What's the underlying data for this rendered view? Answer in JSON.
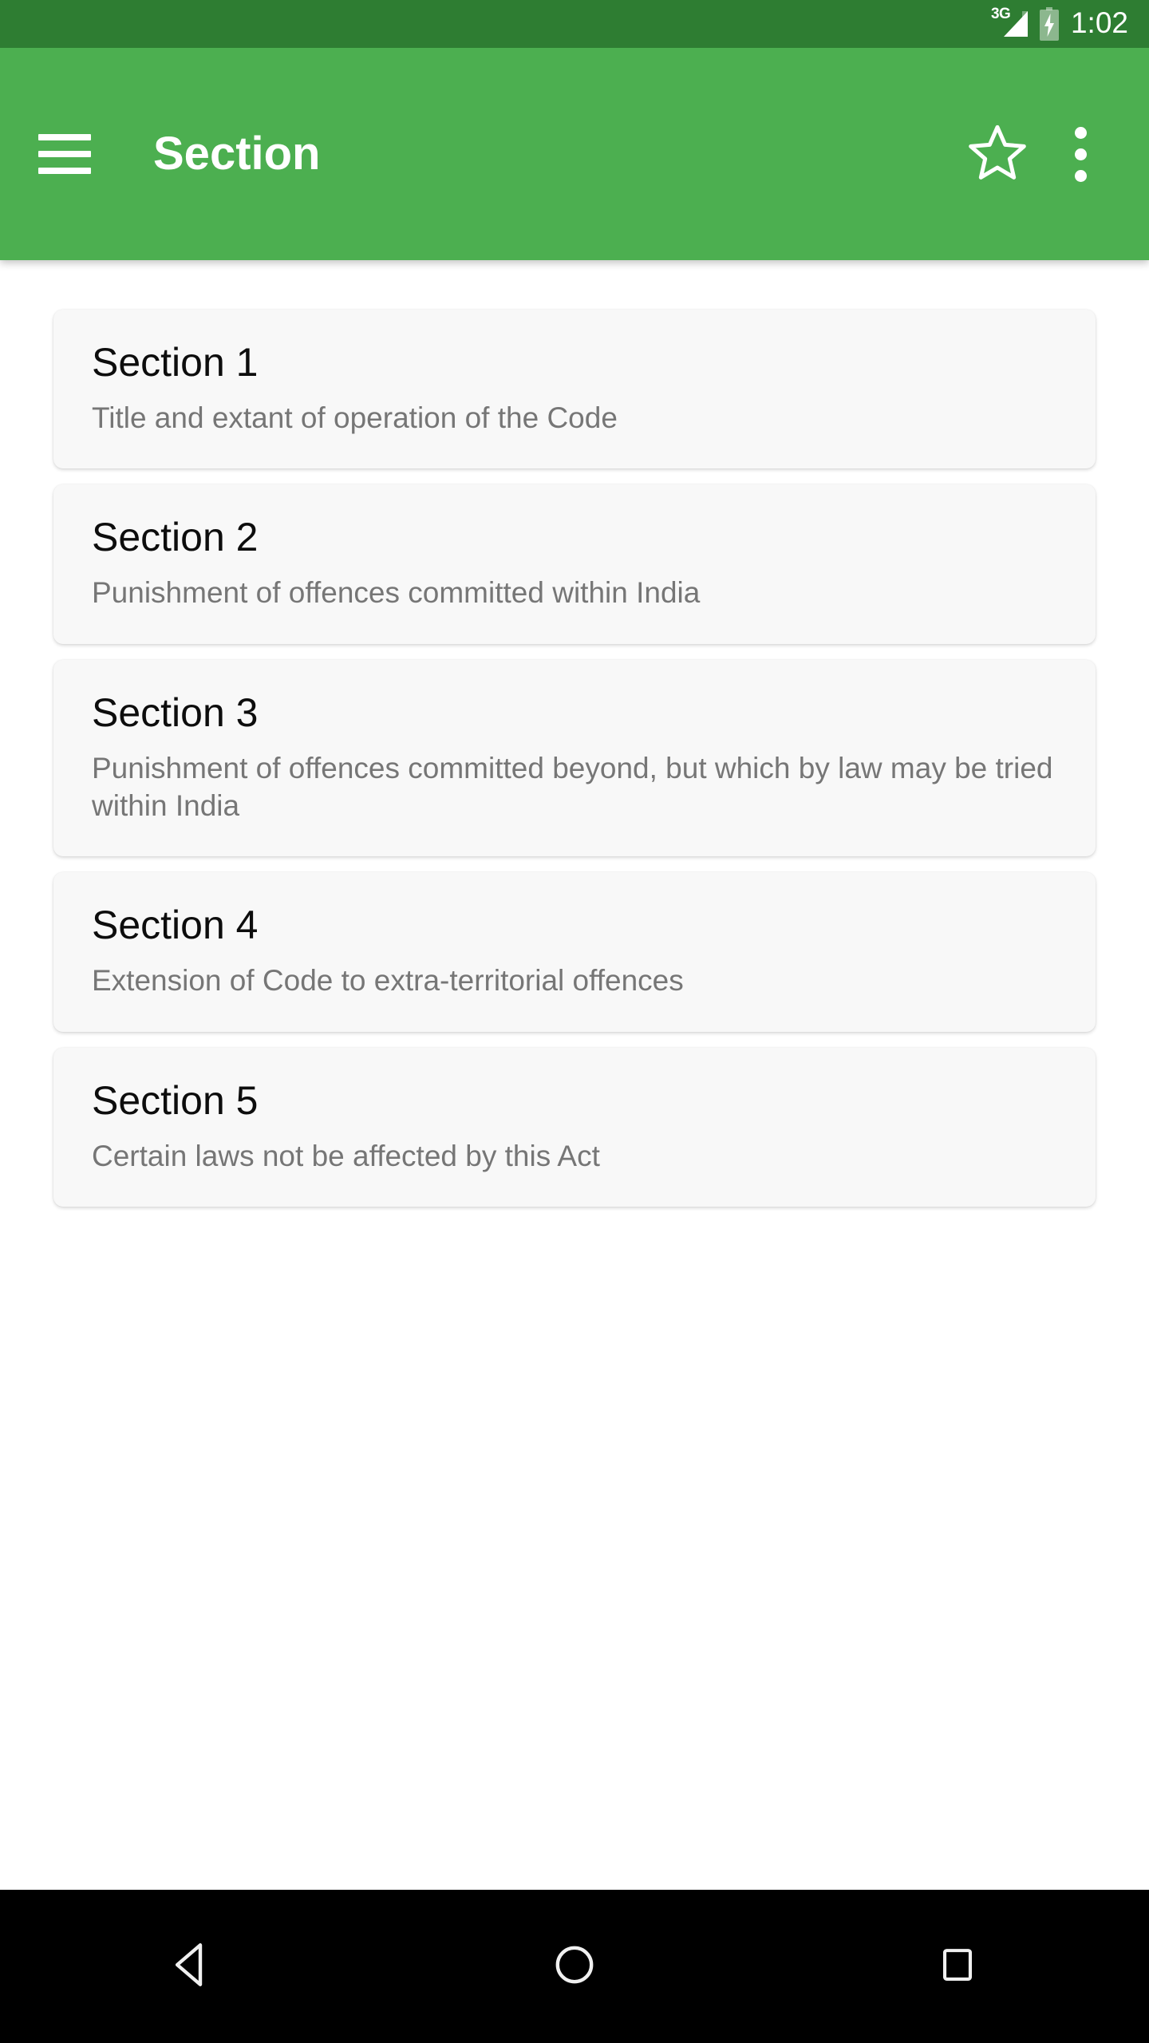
{
  "status_bar": {
    "network_label": "3G",
    "time": "1:02",
    "background_color": "#2e7d32",
    "icons": [
      "signal-icon",
      "battery-charging-icon"
    ]
  },
  "app_bar": {
    "title": "Section",
    "background_color": "#4caf50",
    "menu_icon": "hamburger-menu-icon",
    "favorite_icon": "star-outline-icon",
    "overflow_icon": "overflow-menu-icon"
  },
  "list": {
    "items": [
      {
        "title": "Section 1",
        "subtitle": "Title and extant of operation of the Code"
      },
      {
        "title": "Section 2",
        "subtitle": "Punishment of offences committed within India"
      },
      {
        "title": "Section 3",
        "subtitle": "Punishment of offences committed beyond, but which by law may be tried within India"
      },
      {
        "title": "Section 4",
        "subtitle": "Extension of Code to extra-territorial offences"
      },
      {
        "title": "Section 5",
        "subtitle": "Certain laws not be affected by this Act"
      }
    ]
  },
  "nav_bar": {
    "background_color": "#000000",
    "buttons": [
      {
        "name": "back-button",
        "icon": "back-triangle-icon"
      },
      {
        "name": "home-button",
        "icon": "home-circle-icon"
      },
      {
        "name": "recents-button",
        "icon": "recents-square-icon"
      }
    ]
  }
}
